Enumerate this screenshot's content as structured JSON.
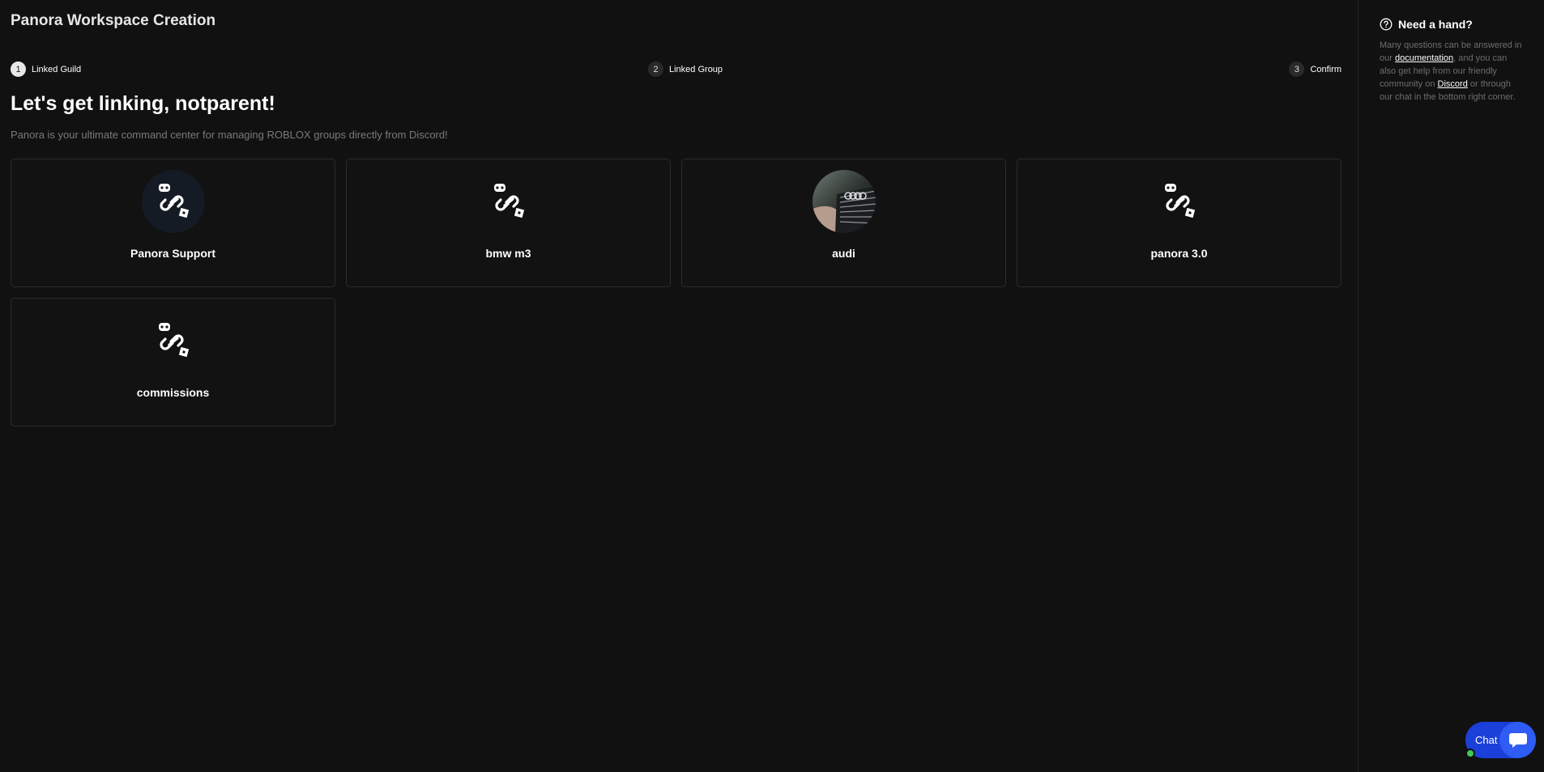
{
  "app": {
    "title": "Panora Workspace Creation"
  },
  "steps": [
    {
      "num": "1",
      "label": "Linked Guild"
    },
    {
      "num": "2",
      "label": "Linked Group"
    },
    {
      "num": "3",
      "label": "Confirm"
    }
  ],
  "main": {
    "heading": "Let's get linking, notparent!",
    "subtitle": "Panora is your ultimate command center for managing ROBLOX groups directly from Discord!"
  },
  "guilds": [
    {
      "name": "Panora Support",
      "icon": "link-icon"
    },
    {
      "name": "bmw m3",
      "icon": "link-icon"
    },
    {
      "name": "audi",
      "icon": "guild-photo"
    },
    {
      "name": "panora 3.0",
      "icon": "link-icon"
    },
    {
      "name": "commissions",
      "icon": "link-icon"
    }
  ],
  "help": {
    "title": "Need a hand?",
    "text_1": "Many questions can be answered in our ",
    "link_docs": "documentation",
    "text_2": ", and you can also get help from our friendly community on ",
    "link_discord": "Discord",
    "text_3": " or through our chat in the bottom right corner."
  },
  "chat": {
    "label": "Chat"
  },
  "colors": {
    "accent": "#2e5cf4",
    "background": "#111111",
    "online": "#3ec95a"
  }
}
